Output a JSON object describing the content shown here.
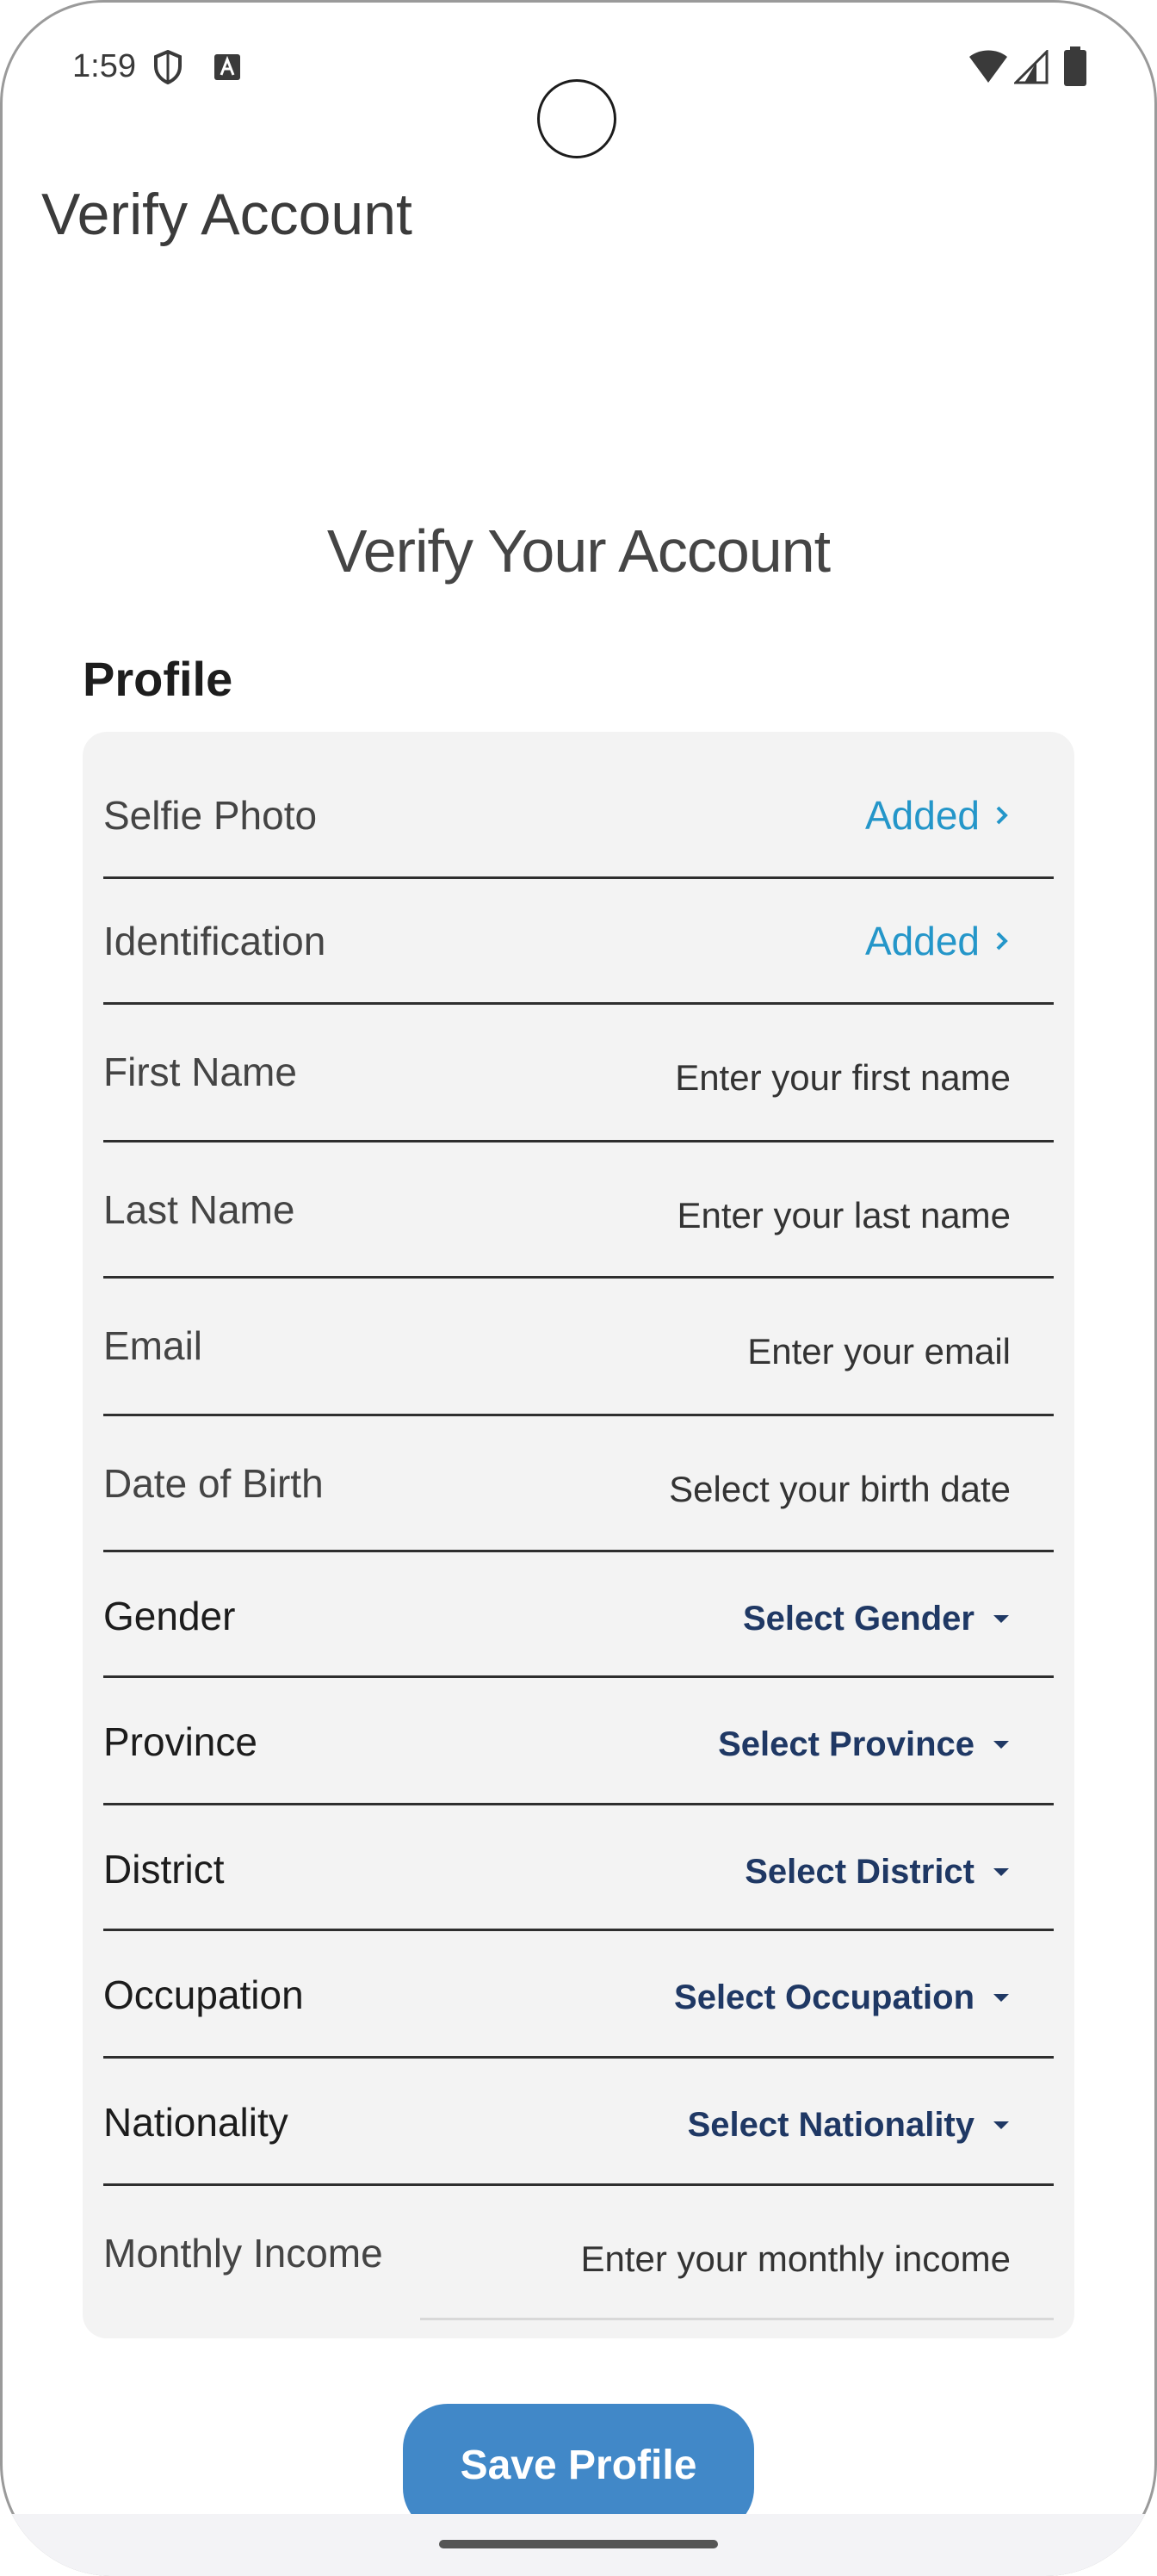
{
  "status_bar": {
    "time": "1:59"
  },
  "app_bar": {
    "title": "Verify Account"
  },
  "page": {
    "heading": "Verify Your Account",
    "section_title": "Profile"
  },
  "profile": {
    "selfie": {
      "label": "Selfie Photo",
      "value": "Added"
    },
    "identification": {
      "label": "Identification",
      "value": "Added"
    },
    "first_name": {
      "label": "First Name",
      "placeholder": "Enter your first name"
    },
    "last_name": {
      "label": "Last Name",
      "placeholder": "Enter your last name"
    },
    "email": {
      "label": "Email",
      "placeholder": "Enter your email"
    },
    "dob": {
      "label": "Date of Birth",
      "placeholder": "Select your birth date"
    },
    "gender": {
      "label": "Gender",
      "value": "Select Gender"
    },
    "province": {
      "label": "Province",
      "value": "Select Province"
    },
    "district": {
      "label": "District",
      "value": "Select District"
    },
    "occupation": {
      "label": "Occupation",
      "value": "Select Occupation"
    },
    "nationality": {
      "label": "Nationality",
      "value": "Select Nationality"
    },
    "monthly_income": {
      "label": "Monthly Income",
      "placeholder": "Enter your monthly income"
    }
  },
  "actions": {
    "save_label": "Save Profile"
  },
  "colors": {
    "accent": "#4188c8",
    "link": "#2496c9",
    "select": "#1f3864"
  }
}
